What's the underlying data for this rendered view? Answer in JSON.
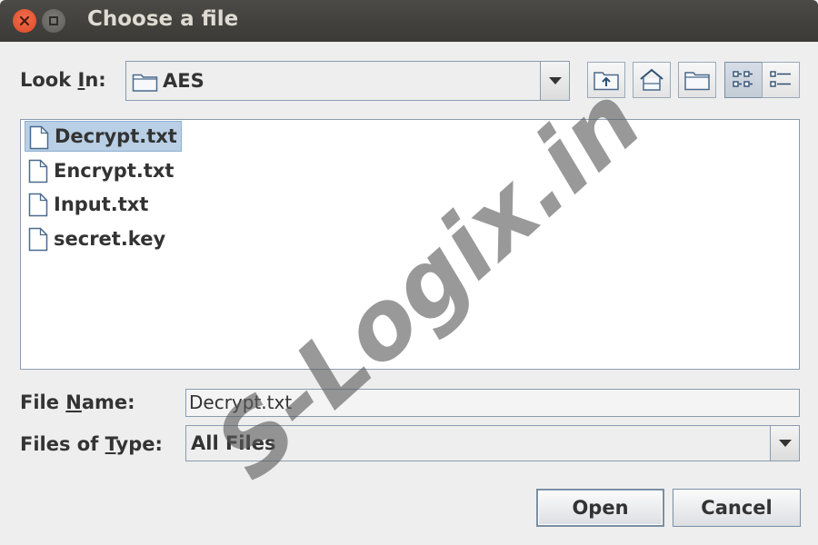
{
  "window": {
    "title": "Choose a file"
  },
  "look_in": {
    "label_prefix": "Look ",
    "label_mnemonic": "I",
    "label_suffix": "n:",
    "value": "AES"
  },
  "toolbar": {
    "buttons": [
      {
        "icon": "up-folder-icon"
      },
      {
        "icon": "home-icon"
      },
      {
        "icon": "new-folder-icon"
      },
      {
        "icon": "list-view-icon",
        "active": true
      },
      {
        "icon": "details-view-icon"
      }
    ]
  },
  "files": [
    {
      "name": "Decrypt.txt",
      "selected": true
    },
    {
      "name": "Encrypt.txt",
      "selected": false
    },
    {
      "name": "Input.txt",
      "selected": false
    },
    {
      "name": "secret.key",
      "selected": false
    }
  ],
  "file_name": {
    "label_prefix": "File ",
    "label_mnemonic": "N",
    "label_suffix": "ame:",
    "value": "Decrypt.txt"
  },
  "files_of_type": {
    "label_prefix": "Files of ",
    "label_mnemonic": "T",
    "label_suffix": "ype:",
    "value": "All Files"
  },
  "actions": {
    "open_label": "Open",
    "cancel_label": "Cancel"
  },
  "watermark": {
    "text": "S-Logix.in"
  },
  "colors": {
    "selection": "#b8cfe5",
    "border": "#8a9cb0",
    "close_button": "#dd4a26"
  }
}
